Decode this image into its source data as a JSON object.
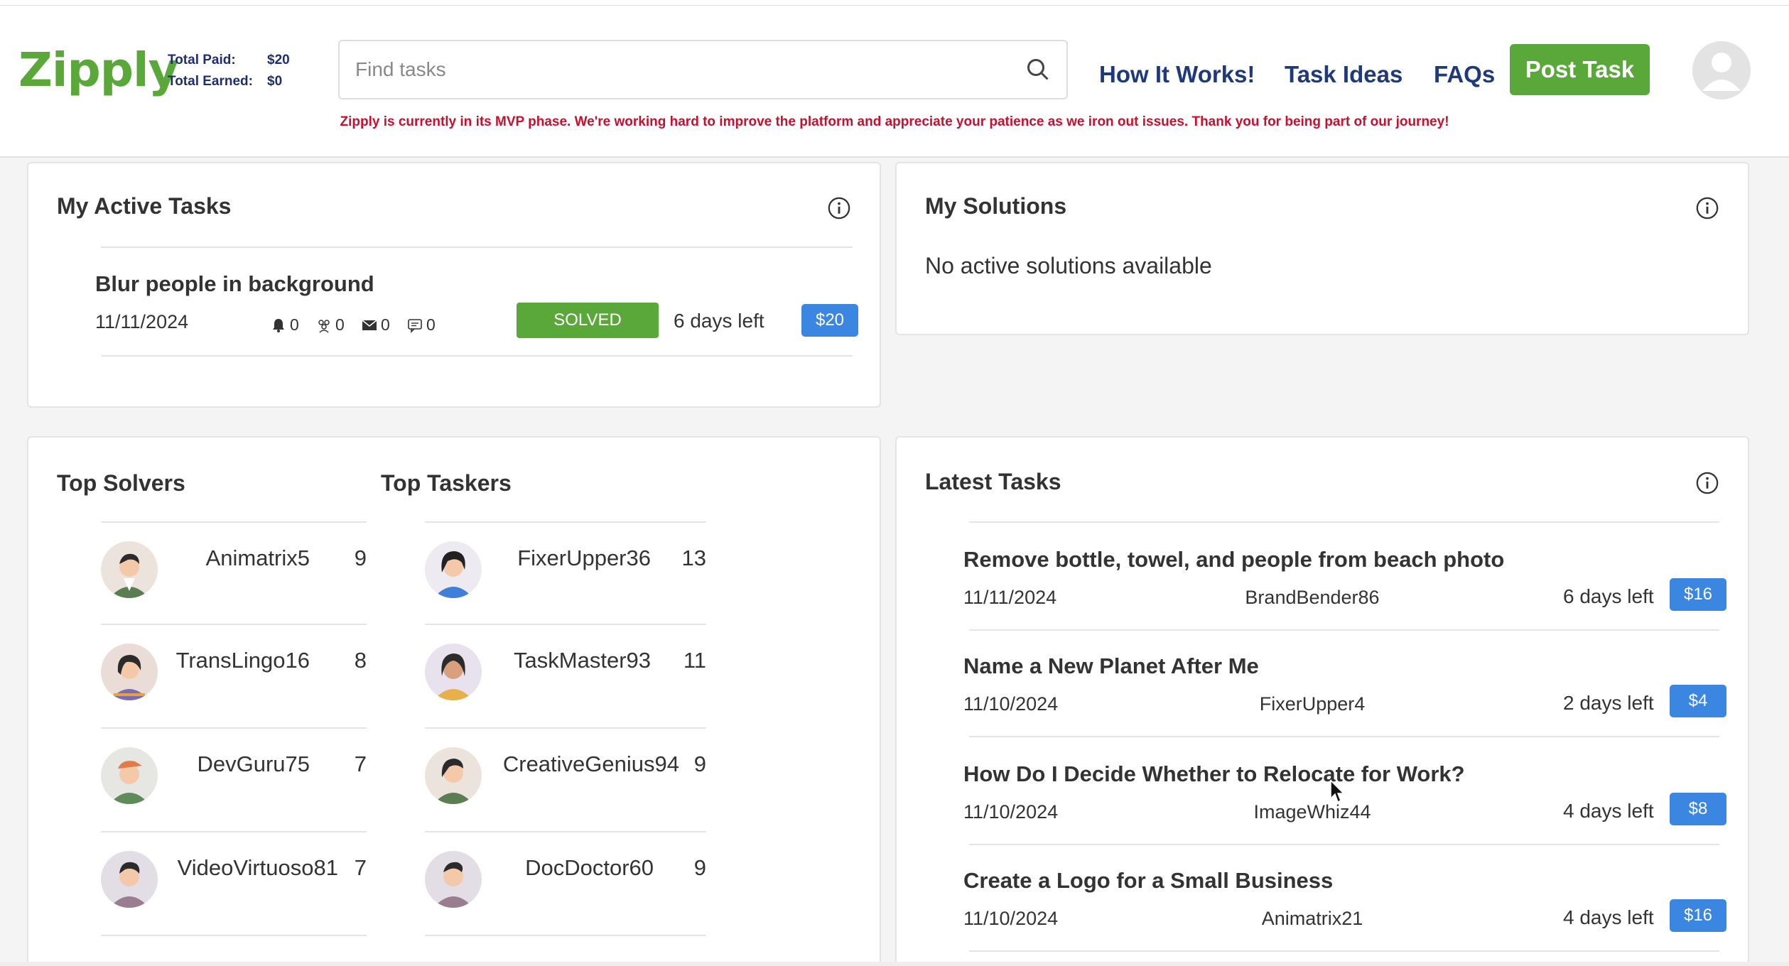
{
  "header": {
    "logo": "Zipply",
    "total_paid_label": "Total Paid:",
    "total_paid_value": "$20",
    "total_earned_label": "Total Earned:",
    "total_earned_value": "$0",
    "search_placeholder": "Find tasks",
    "nav": [
      "How It Works!",
      "Task Ideas",
      "FAQs"
    ],
    "post_task": "Post Task",
    "notice": "Zipply is currently in its MVP phase. We're working hard to improve the platform and appreciate your patience as we iron out issues. Thank you for being part of our journey!"
  },
  "active_tasks": {
    "title": "My Active Tasks",
    "items": [
      {
        "title": "Blur people in background",
        "date": "11/11/2024",
        "notifications": "0",
        "solvers": "0",
        "messages": "0",
        "comments": "0",
        "status": "SOLVED",
        "days_left": "6 days left",
        "price": "$20"
      }
    ]
  },
  "solutions": {
    "title": "My Solutions",
    "empty_text": "No active solutions available"
  },
  "top_solvers": {
    "title": "Top Solvers",
    "items": [
      {
        "name": "Animatrix5",
        "score": "9"
      },
      {
        "name": "TransLingo16",
        "score": "8"
      },
      {
        "name": "DevGuru75",
        "score": "7"
      },
      {
        "name": "VideoVirtuoso81",
        "score": "7"
      }
    ]
  },
  "top_taskers": {
    "title": "Top Taskers",
    "items": [
      {
        "name": "FixerUpper36",
        "score": "13"
      },
      {
        "name": "TaskMaster93",
        "score": "11"
      },
      {
        "name": "CreativeGenius94",
        "score": "9"
      },
      {
        "name": "DocDoctor60",
        "score": "9"
      }
    ]
  },
  "latest_tasks": {
    "title": "Latest Tasks",
    "items": [
      {
        "title": "Remove bottle, towel, and people from beach photo",
        "date": "11/11/2024",
        "user": "BrandBender86",
        "days_left": "6 days left",
        "price": "$16"
      },
      {
        "title": "Name a New Planet After Me",
        "date": "11/10/2024",
        "user": "FixerUpper4",
        "days_left": "2 days left",
        "price": "$4"
      },
      {
        "title": "How Do I Decide Whether to Relocate for Work?",
        "date": "11/10/2024",
        "user": "ImageWhiz44",
        "days_left": "4 days left",
        "price": "$8"
      },
      {
        "title": "Create a Logo for a Small Business",
        "date": "11/10/2024",
        "user": "Animatrix21",
        "days_left": "4 days left",
        "price": "$16"
      }
    ]
  },
  "colors": {
    "brand_green": "#5aa83a",
    "nav_blue": "#1f3a7a",
    "price_blue": "#3a86e0",
    "notice_red": "#c8102e"
  }
}
